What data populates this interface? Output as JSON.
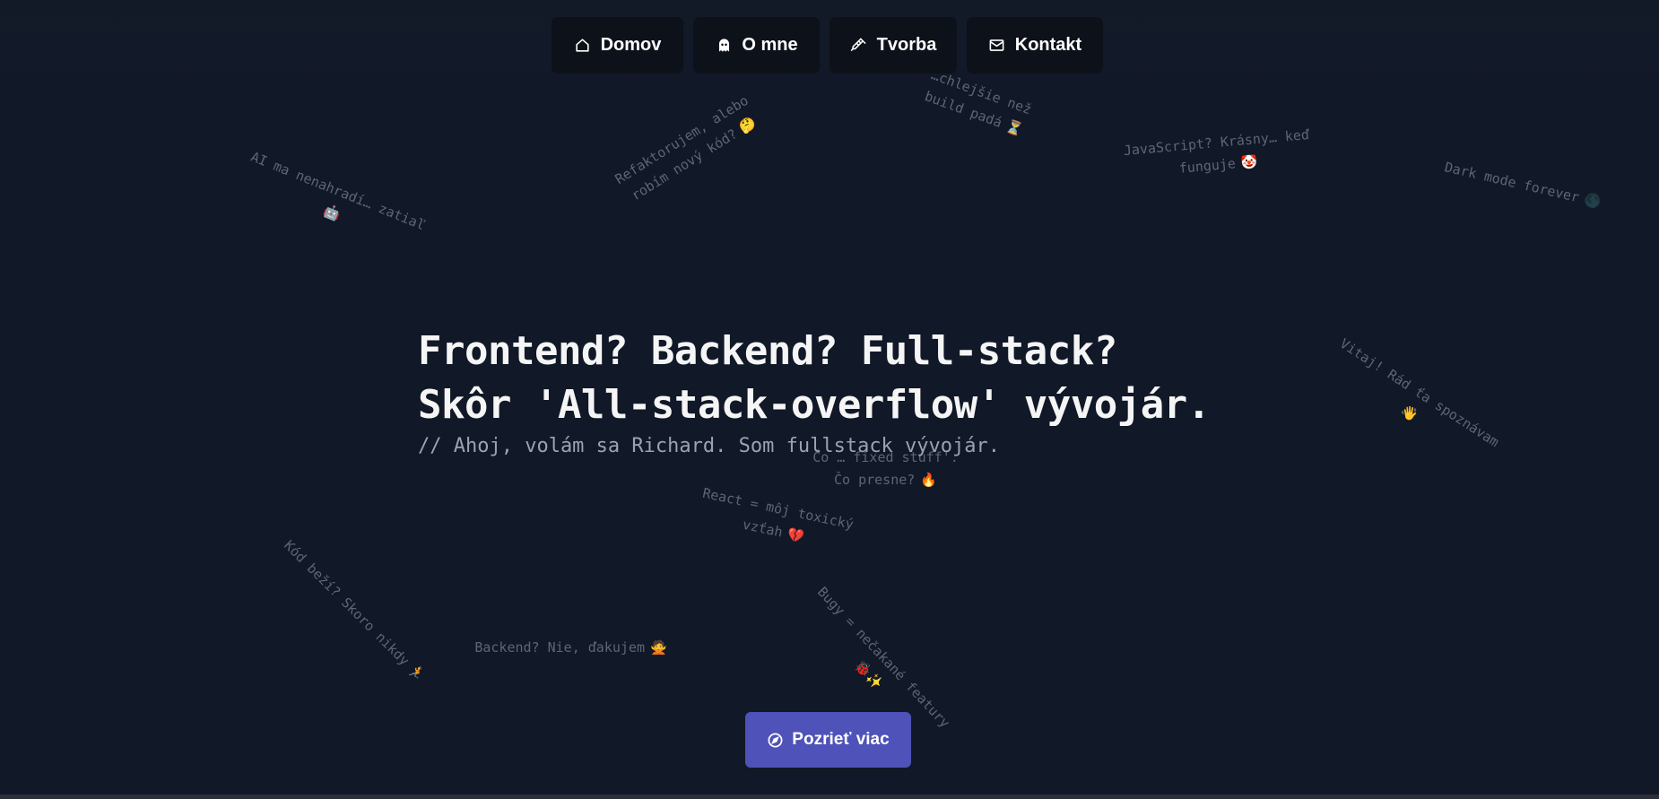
{
  "nav": {
    "items": [
      {
        "label": "Domov",
        "icon": "home-icon"
      },
      {
        "label": "O mne",
        "icon": "ghost-icon"
      },
      {
        "label": "Tvorba",
        "icon": "syringe-icon"
      },
      {
        "label": "Kontakt",
        "icon": "mail-icon"
      }
    ]
  },
  "hero": {
    "line1": "Frontend? Backend? Full-stack?",
    "line2": "Skôr 'All-stack-overflow' vývojár.",
    "subtitle": "// Ahoj, volám sa Richard. Som fullstack vývojár."
  },
  "floaters": {
    "ai": {
      "line1": "AI ma nenahradí… zatiaľ",
      "emoji": "🤖"
    },
    "refactor": {
      "line1": "Refaktorujem, alebo",
      "line2": "robím nový kód?",
      "emoji": "🤔"
    },
    "build": {
      "line1": "…chlejšie než",
      "line2": "build padá",
      "emoji": "⏳"
    },
    "javascript": {
      "line1": "JavaScript? Krásny… keď",
      "line2": "funguje",
      "emoji": "🤡"
    },
    "darkmode": {
      "line1": "Dark mode forever",
      "emoji": "🌑"
    },
    "vitaj": {
      "line1": "Vitaj! Rád ťa spoznávam",
      "emoji": "👋"
    },
    "fixed": {
      "line1": "Čo … fixed stuff'.",
      "line2": "Čo presne?",
      "emoji": "🔥"
    },
    "react": {
      "line1": "React = môj toxický",
      "line2": "vzťah",
      "emoji": "💔"
    },
    "kod": {
      "line1": "Kód beží? Skoro nikdy",
      "emoji": "🏃"
    },
    "backend": {
      "line1": "Backend? Nie, ďakujem",
      "emoji": "🙅"
    },
    "bugy": {
      "line1": "Bugy = nečakané featury",
      "emoji": "🐞✨"
    }
  },
  "cta": {
    "label": "Pozrieť viac",
    "icon": "compass-icon"
  },
  "colors": {
    "background": "#111827",
    "nav_bg": "#0d1119",
    "accent": "#4f52b8",
    "floater_text": "#5d6675"
  }
}
